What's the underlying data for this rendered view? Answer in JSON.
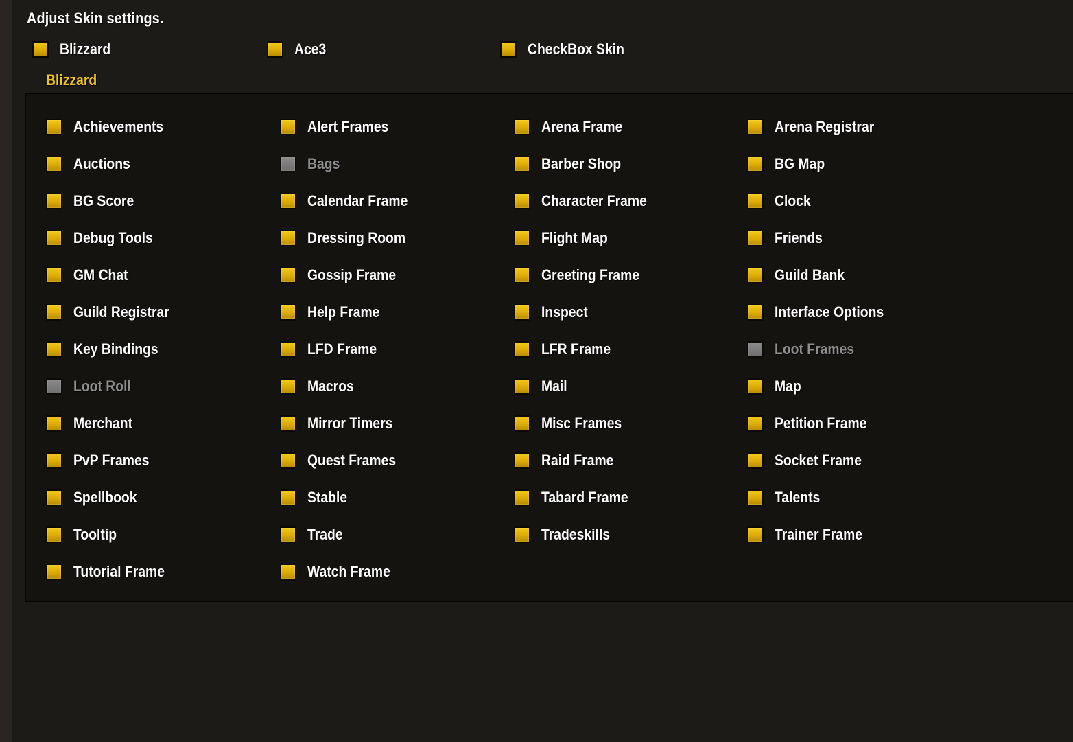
{
  "header": "Adjust Skin settings.",
  "top_options": [
    {
      "label": "Blizzard",
      "checked": true
    },
    {
      "label": "Ace3",
      "checked": true
    },
    {
      "label": "CheckBox Skin",
      "checked": true
    }
  ],
  "group_title": "Blizzard",
  "colors": {
    "checked": "#dcab06",
    "unchecked": "#7a7a7a",
    "accent_title": "#f3c61b",
    "disabled_text": "#8d8d8d"
  },
  "items": [
    {
      "label": "Achievements",
      "checked": true
    },
    {
      "label": "Alert Frames",
      "checked": true
    },
    {
      "label": "Arena Frame",
      "checked": true
    },
    {
      "label": "Arena Registrar",
      "checked": true
    },
    {
      "label": "Auctions",
      "checked": true
    },
    {
      "label": "Bags",
      "checked": false
    },
    {
      "label": "Barber Shop",
      "checked": true
    },
    {
      "label": "BG Map",
      "checked": true
    },
    {
      "label": "BG Score",
      "checked": true
    },
    {
      "label": "Calendar Frame",
      "checked": true
    },
    {
      "label": "Character Frame",
      "checked": true
    },
    {
      "label": "Clock",
      "checked": true
    },
    {
      "label": "Debug Tools",
      "checked": true
    },
    {
      "label": "Dressing Room",
      "checked": true
    },
    {
      "label": "Flight Map",
      "checked": true
    },
    {
      "label": "Friends",
      "checked": true
    },
    {
      "label": "GM Chat",
      "checked": true
    },
    {
      "label": "Gossip Frame",
      "checked": true
    },
    {
      "label": "Greeting Frame",
      "checked": true
    },
    {
      "label": "Guild Bank",
      "checked": true
    },
    {
      "label": "Guild Registrar",
      "checked": true
    },
    {
      "label": "Help Frame",
      "checked": true
    },
    {
      "label": "Inspect",
      "checked": true
    },
    {
      "label": "Interface Options",
      "checked": true
    },
    {
      "label": "Key Bindings",
      "checked": true
    },
    {
      "label": "LFD Frame",
      "checked": true
    },
    {
      "label": "LFR Frame",
      "checked": true
    },
    {
      "label": "Loot Frames",
      "checked": false
    },
    {
      "label": "Loot Roll",
      "checked": false
    },
    {
      "label": "Macros",
      "checked": true
    },
    {
      "label": "Mail",
      "checked": true
    },
    {
      "label": "Map",
      "checked": true
    },
    {
      "label": "Merchant",
      "checked": true
    },
    {
      "label": "Mirror Timers",
      "checked": true
    },
    {
      "label": "Misc Frames",
      "checked": true
    },
    {
      "label": "Petition Frame",
      "checked": true
    },
    {
      "label": "PvP Frames",
      "checked": true
    },
    {
      "label": "Quest Frames",
      "checked": true
    },
    {
      "label": "Raid Frame",
      "checked": true
    },
    {
      "label": "Socket Frame",
      "checked": true
    },
    {
      "label": "Spellbook",
      "checked": true
    },
    {
      "label": "Stable",
      "checked": true
    },
    {
      "label": "Tabard Frame",
      "checked": true
    },
    {
      "label": "Talents",
      "checked": true
    },
    {
      "label": "Tooltip",
      "checked": true
    },
    {
      "label": "Trade",
      "checked": true
    },
    {
      "label": "Tradeskills",
      "checked": true
    },
    {
      "label": "Trainer Frame",
      "checked": true
    },
    {
      "label": "Tutorial Frame",
      "checked": true
    },
    {
      "label": "Watch Frame",
      "checked": true
    }
  ]
}
